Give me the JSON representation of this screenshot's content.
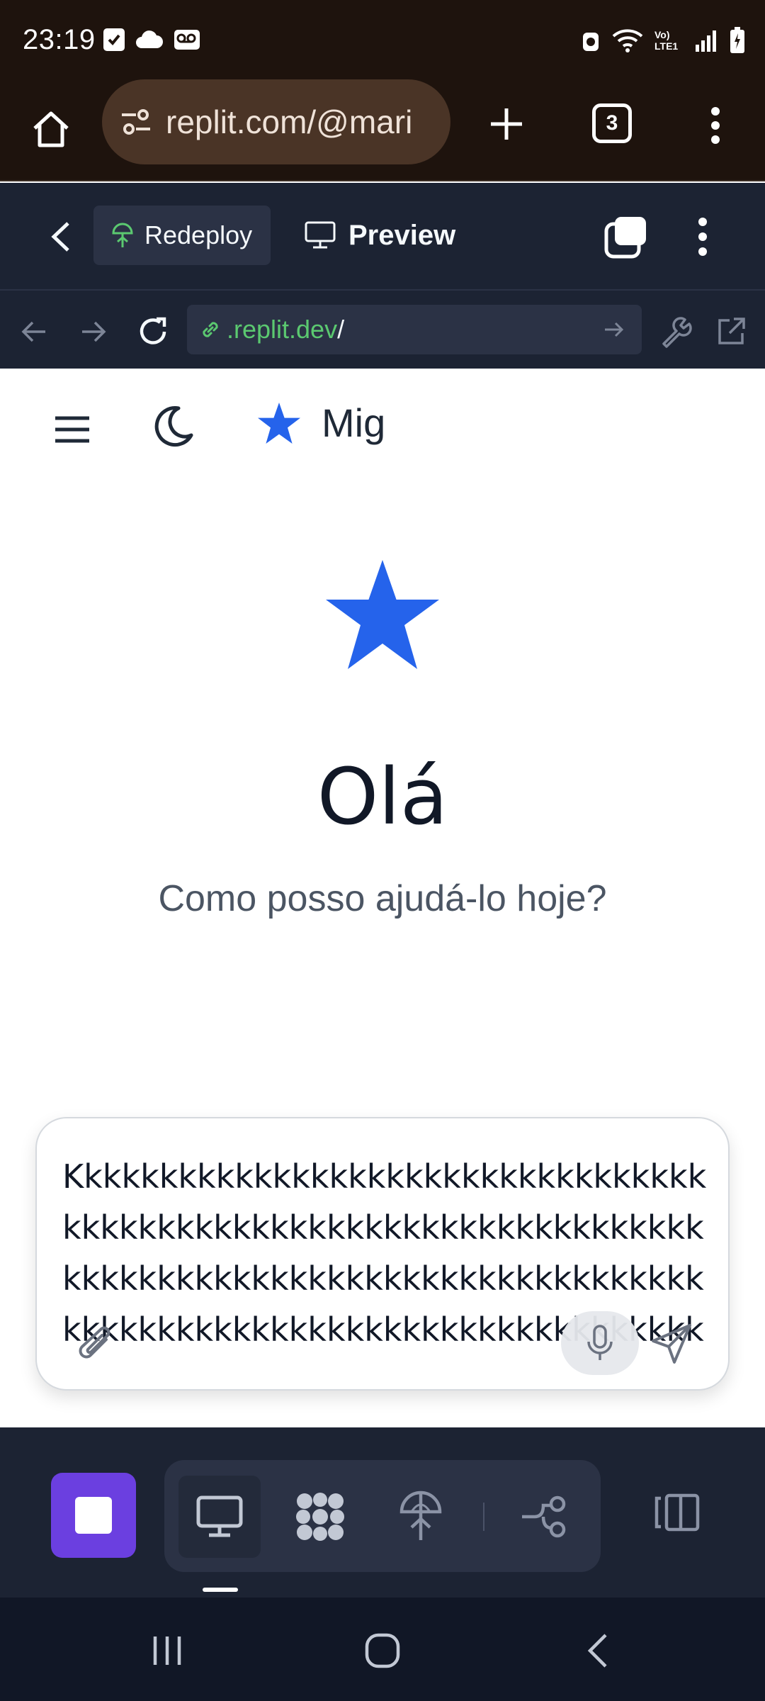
{
  "status_bar": {
    "time": "23:19",
    "left_icons": [
      "check-icon",
      "cloud-icon",
      "voicemail-icon"
    ],
    "right_icons": [
      "alarm-icon",
      "wifi-icon",
      "volte-icon",
      "signal-icon",
      "battery-icon"
    ],
    "volte_label": "Vo) LTE1"
  },
  "chrome": {
    "url": "replit.com/@mari",
    "tab_count": "3"
  },
  "replit_header": {
    "redeploy_label": "Redeploy",
    "preview_label": "Preview"
  },
  "webview": {
    "url_domain": ".replit.dev",
    "url_path": "/"
  },
  "app": {
    "brand_name": "Mig",
    "title": "Olá",
    "subtitle": "Como posso ajudá-lo hoje?",
    "composer_text": "Kkkkkkkkkkkkkkkkkkkkkkkkkkkkkkkkkkkkkkkkkkkkkkkkkkkkkkkkkkkkkkkkkkkkkkkkkkkkkkkkkkkkkkkkkkkkkkkkkkkkkkkkkkkkkkkkkkkkkkkkkkkkkkkkkkkkkkkkkkkkkkkkkkk",
    "accent_color": "#2563eb"
  },
  "dock": {
    "stop_color": "#6b3fe0",
    "items": [
      "preview-icon",
      "cluster-icon",
      "deploy-icon",
      "git-icon"
    ]
  }
}
